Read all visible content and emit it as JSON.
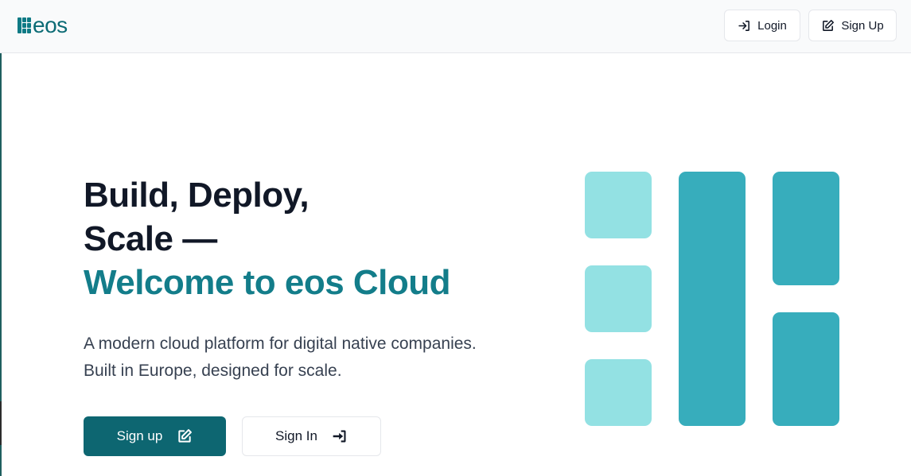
{
  "brand": {
    "name": "eos",
    "accent": "#137d8a",
    "primary": "#0d6671",
    "light_block": "#93e1e3",
    "mid_block": "#37adbc"
  },
  "header": {
    "login_label": "Login",
    "login_icon": "sign-in-icon",
    "signup_label": "Sign Up",
    "signup_icon": "edit-icon"
  },
  "hero": {
    "title_line1": "Build, Deploy,",
    "title_line2": "Scale —",
    "title_accent": "Welcome to eos Cloud",
    "subtitle_line1": "A modern cloud platform for digital native companies.",
    "subtitle_line2": "Built in Europe, designed for scale.",
    "primary_cta": "Sign up",
    "primary_cta_icon": "edit-icon",
    "secondary_cta": "Sign In",
    "secondary_cta_icon": "sign-in-icon"
  }
}
